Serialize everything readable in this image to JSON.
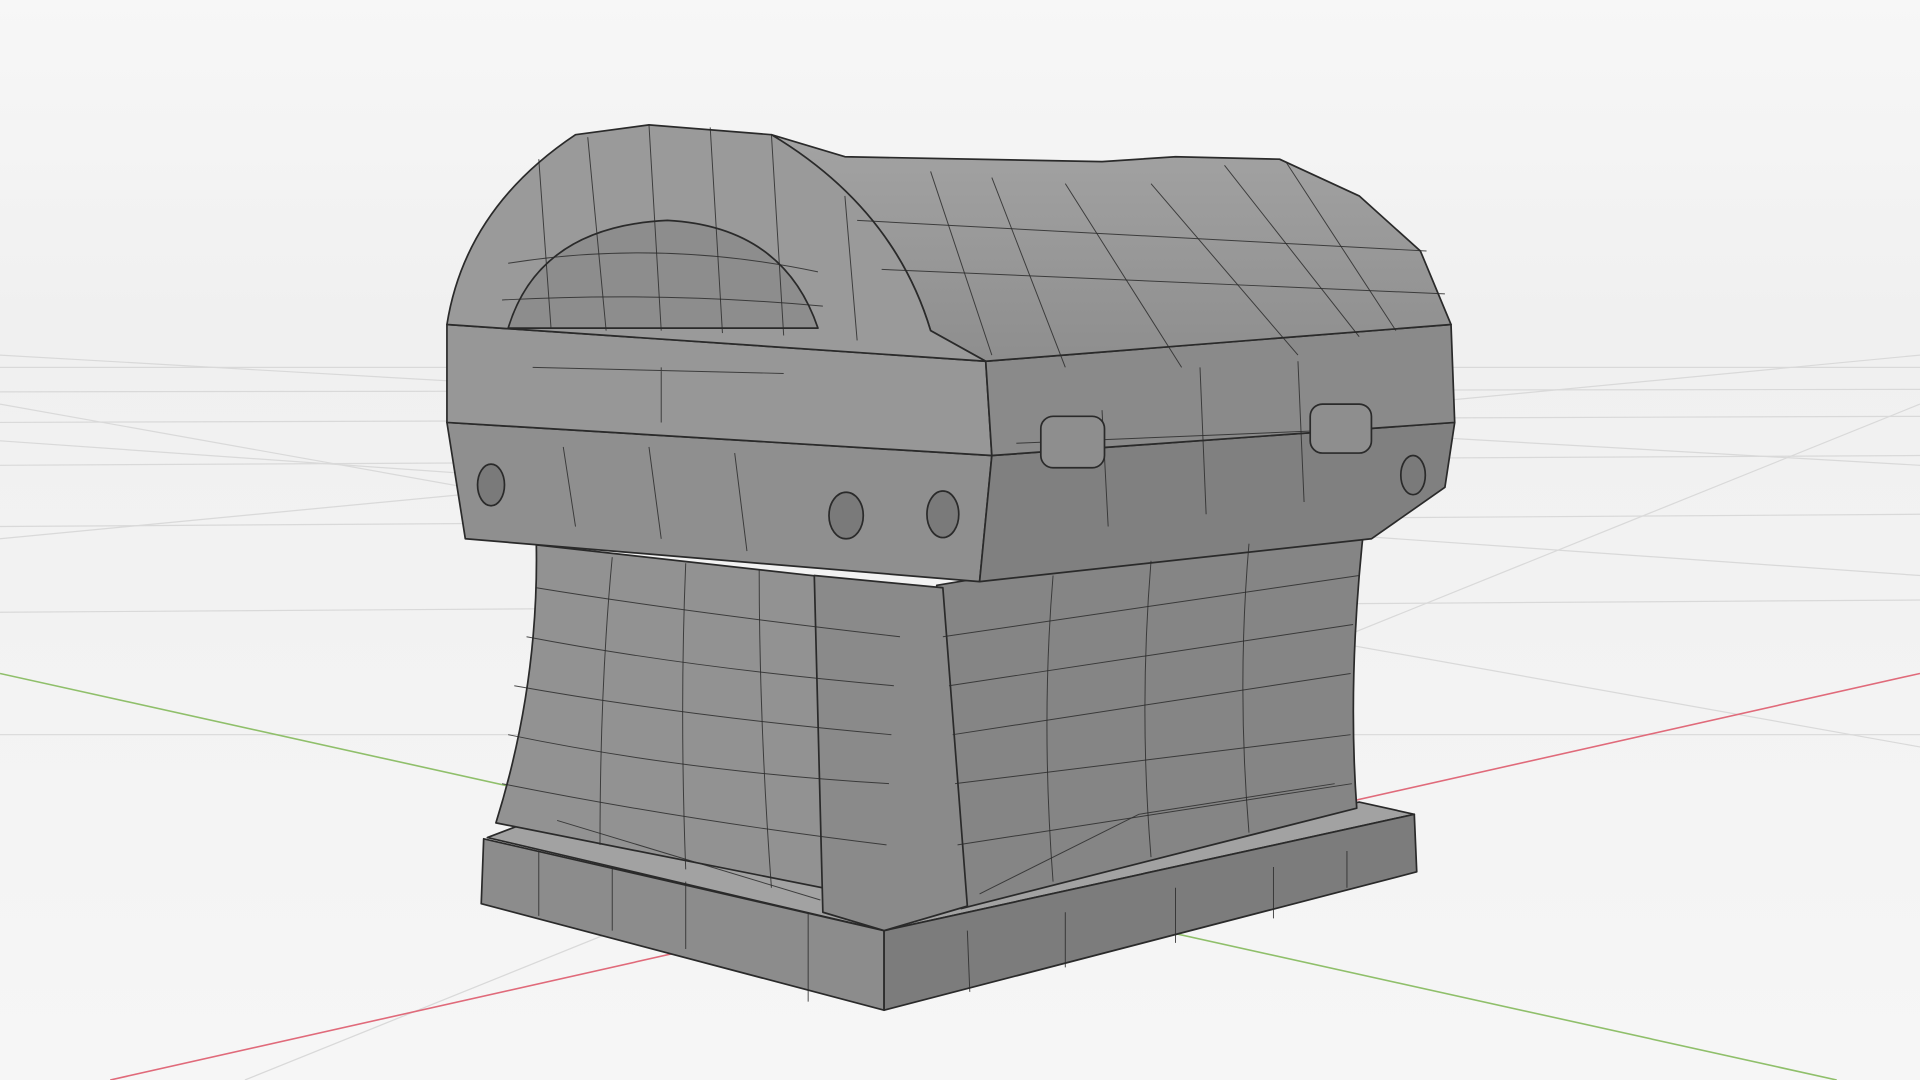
{
  "scene": {
    "object": "treasure-chest",
    "colors": {
      "background": "#f2f2f2",
      "grid": "#d9d9d9",
      "x_axis": "#e06a7a",
      "y_axis": "#8fbf6a",
      "mesh_light": "#9c9c9c",
      "mesh_mid": "#8a8a8a",
      "mesh_dark": "#777777",
      "wire": "#2a2a2a"
    }
  }
}
